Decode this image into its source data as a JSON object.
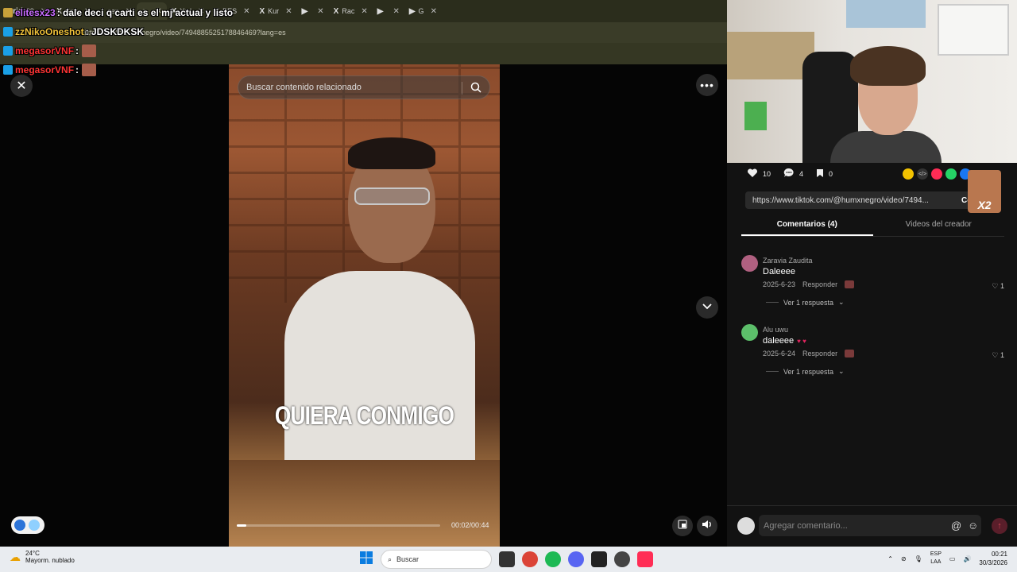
{
  "browser": {
    "tabs": [
      {
        "icon": "grid",
        "label": "99"
      },
      {
        "icon": "X",
        "label": "Spe"
      },
      {
        "icon": "♪",
        "label": "cen"
      },
      {
        "icon": "♪",
        "label": ""
      },
      {
        "icon": "X",
        "label": "Ye l"
      },
      {
        "icon": "X",
        "label": "PES"
      },
      {
        "icon": "X",
        "label": "Kur"
      },
      {
        "icon": "▶",
        "label": ""
      },
      {
        "icon": "X",
        "label": "Rac"
      },
      {
        "icon": "▶",
        "label": ""
      },
      {
        "icon": "▶",
        "label": "G"
      }
    ],
    "url": "tiktok.com/@humxnegro/video/7494885525178846469?lang=es"
  },
  "chat": [
    {
      "user": "elitesx23",
      "message": ": dale deci q carti es el mj actual y listo",
      "user_color": "#c86cff"
    },
    {
      "user": "zzNikoOneshot",
      "message": ": JDSKDKSK",
      "user_color": "#f0c23a"
    },
    {
      "user": "megasorVNF",
      "message": ":",
      "user_color": "#ff3434"
    },
    {
      "user": "megasorVNF",
      "message": ":",
      "user_color": "#ff3434"
    }
  ],
  "player": {
    "search_placeholder": "Buscar contenido relacionado",
    "caption": "QUIERA CONMIGO",
    "time": "00:02/00:44",
    "progress": 0.045
  },
  "stats": {
    "likes": "10",
    "comments": "4",
    "saves": "0"
  },
  "link": {
    "url": "https://www.tiktok.com/@humxnegro/video/7494...",
    "copy_label": "Copiar e"
  },
  "overlay_badge": "X2",
  "tabs": {
    "comments": "Comentarios (4)",
    "creator": "Videos del creador"
  },
  "comments": [
    {
      "name": "Zaravia Zaudita",
      "text": "Daleeee",
      "date": "2025-6-23",
      "reply": "Responder",
      "likes": "1",
      "more": "Ver 1 respuesta",
      "avatar_color": "#b06080"
    },
    {
      "name": "Alu uwu",
      "text": "daleeee",
      "date": "2025-6-24",
      "reply": "Responder",
      "likes": "1",
      "more": "Ver 1 respuesta",
      "avatar_color": "#5cbf6a"
    }
  ],
  "compose": {
    "placeholder": "Agregar comentario..."
  },
  "taskbar": {
    "temp": "24°C",
    "weather": "Mayorm. nublado",
    "search": "Buscar",
    "lang1": "ESP",
    "lang2": "LAA",
    "time": "00:21",
    "date": "30/3/2026"
  }
}
